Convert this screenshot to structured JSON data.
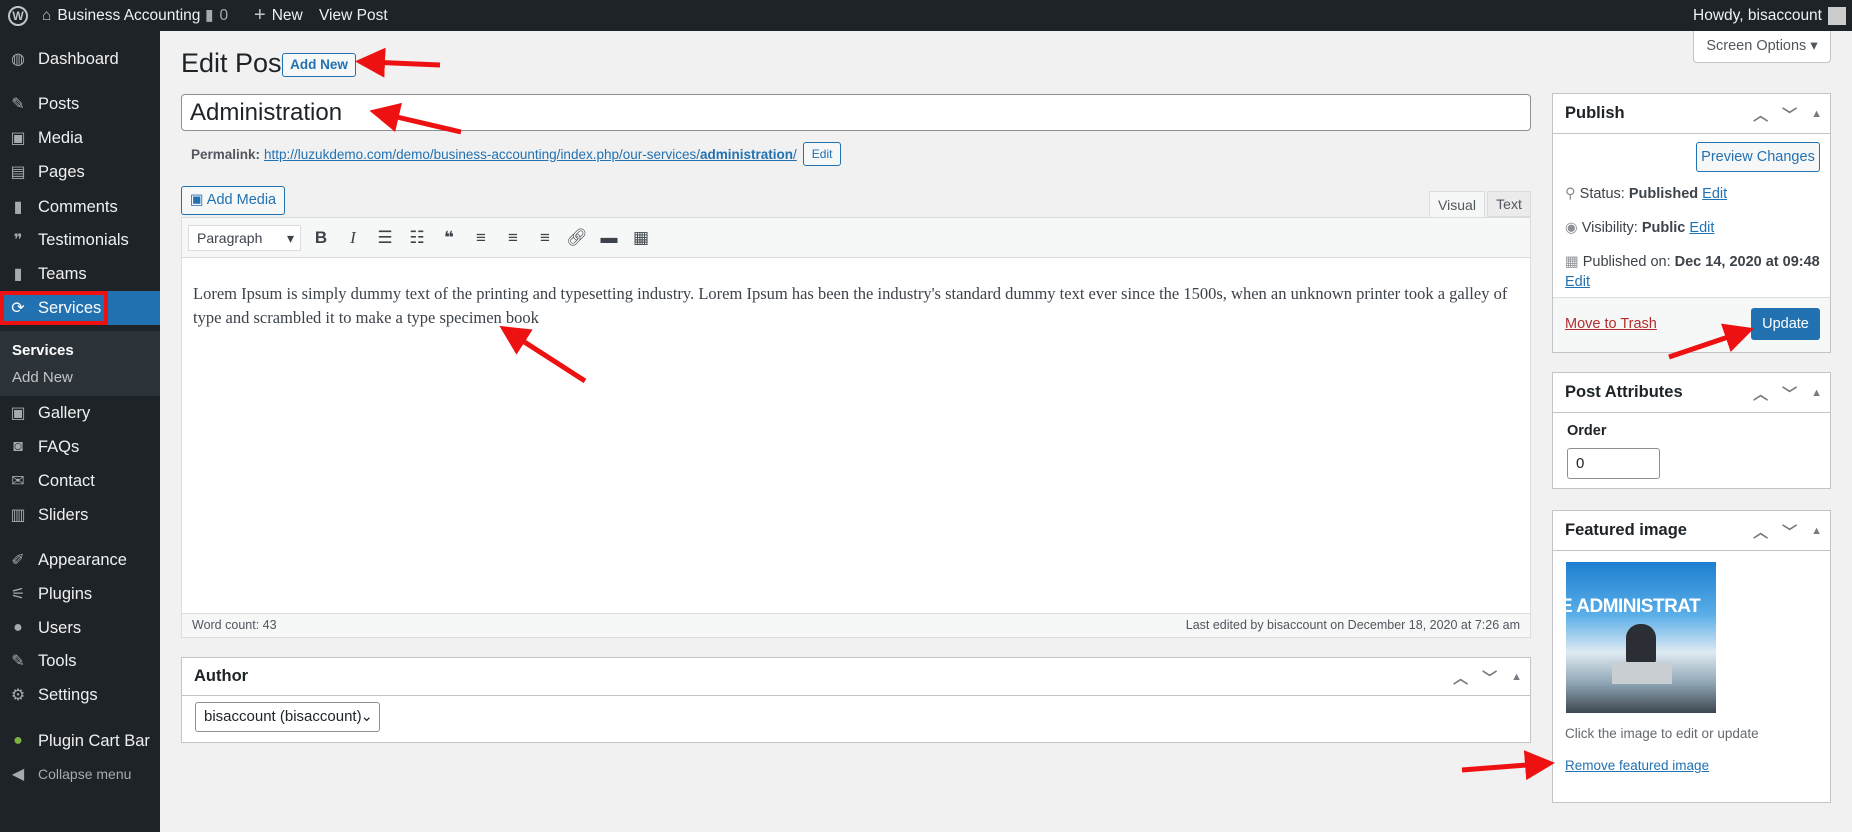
{
  "adminbar": {
    "site": "Business Accounting",
    "comments": "0",
    "new": "New",
    "view": "View Post",
    "howdy": "Howdy, bisaccount"
  },
  "sidebar": {
    "items": [
      {
        "label": "Dashboard",
        "icon": "dashboard-icon"
      },
      {
        "label": "Posts",
        "icon": "pin-icon"
      },
      {
        "label": "Media",
        "icon": "media-icon"
      },
      {
        "label": "Pages",
        "icon": "pages-icon"
      },
      {
        "label": "Comments",
        "icon": "comment-icon"
      },
      {
        "label": "Testimonials",
        "icon": "testimonial-icon"
      },
      {
        "label": "Teams",
        "icon": "teams-icon"
      },
      {
        "label": "Services",
        "icon": "refresh-icon",
        "active": true
      },
      {
        "label": "Gallery",
        "icon": "gallery-icon"
      },
      {
        "label": "FAQs",
        "icon": "faq-icon"
      },
      {
        "label": "Contact",
        "icon": "mail-icon"
      },
      {
        "label": "Sliders",
        "icon": "sliders-icon"
      },
      {
        "label": "Appearance",
        "icon": "brush-icon"
      },
      {
        "label": "Plugins",
        "icon": "plugin-icon"
      },
      {
        "label": "Users",
        "icon": "user-icon"
      },
      {
        "label": "Tools",
        "icon": "wrench-icon"
      },
      {
        "label": "Settings",
        "icon": "settings-icon"
      },
      {
        "label": "Plugin Cart Bar",
        "icon": "leaf-icon"
      }
    ],
    "submenu": [
      "Services",
      "Add New"
    ],
    "collapse": "Collapse menu"
  },
  "page": {
    "title": "Edit Post",
    "add_new": "Add New",
    "screen_options": "Screen Options",
    "post_title": "Administration",
    "permalink_label": "Permalink:",
    "permalink_base": "http://luzukdemo.com/demo/business-accounting/index.php/our-services/",
    "permalink_slug": "administration",
    "permalink_end": "/",
    "permalink_edit": "Edit"
  },
  "editor": {
    "add_media": "Add Media",
    "tab_visual": "Visual",
    "tab_text": "Text",
    "format": "Paragraph",
    "content": "Lorem Ipsum is simply dummy text of the printing and typesetting industry. Lorem Ipsum has been the industry's standard dummy text ever since the 1500s, when an unknown printer took a galley of type and scrambled it to make a type specimen book",
    "word_count": "Word count: 43",
    "last_edited": "Last edited by bisaccount on December 18, 2020 at 7:26 am"
  },
  "author": {
    "title": "Author",
    "value": "bisaccount (bisaccount)"
  },
  "publish": {
    "title": "Publish",
    "preview": "Preview Changes",
    "status_label": "Status:",
    "status": "Published",
    "visibility_label": "Visibility:",
    "visibility": "Public",
    "published_label": "Published on:",
    "published": "Dec 14, 2020 at 09:48",
    "edit": "Edit",
    "trash": "Move to Trash",
    "update": "Update"
  },
  "attributes": {
    "title": "Post Attributes",
    "order_label": "Order",
    "order": "0"
  },
  "featured": {
    "title": "Featured image",
    "image_text": "E ADMINISTRAT",
    "hint": "Click the image to edit or update",
    "remove": "Remove featured image"
  },
  "colors": {
    "accent": "#2271b1",
    "annotation_arrow": "#ee1111"
  }
}
